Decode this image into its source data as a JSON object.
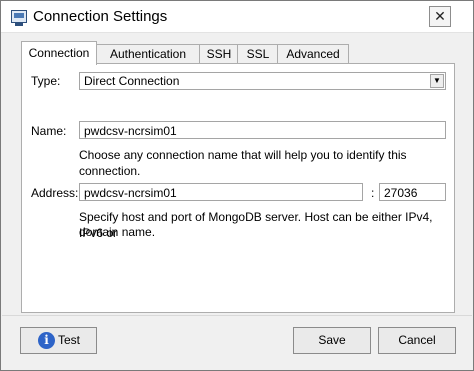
{
  "window": {
    "title": "Connection Settings",
    "icon": "computer-icon",
    "close_glyph": "✕"
  },
  "tabs": [
    {
      "label": "Connection",
      "selected": true
    },
    {
      "label": "Authentication",
      "selected": false
    },
    {
      "label": "SSH",
      "selected": false
    },
    {
      "label": "SSL",
      "selected": false
    },
    {
      "label": "Advanced",
      "selected": false
    }
  ],
  "connection": {
    "type_label": "Type:",
    "type_value": "Direct Connection",
    "name_label": "Name:",
    "name_value": "pwdcsv-ncrsim01",
    "name_help": "Choose any connection name that will help you to identify this connection.",
    "address_label": "Address:",
    "host_value": "pwdcsv-ncrsim01",
    "port_separator": ":",
    "port_value": "27036",
    "address_help_line1": "Specify host and port of MongoDB server. Host can be either IPv4, IPv6 or",
    "address_help_line2": "domain name."
  },
  "footer": {
    "test_label": "Test",
    "save_label": "Save",
    "cancel_label": "Cancel"
  },
  "icons": {
    "info": "i",
    "dropdown": "▼"
  },
  "colors": {
    "info_icon": "#2e64c8",
    "window_bg": "#f0f0f0"
  }
}
